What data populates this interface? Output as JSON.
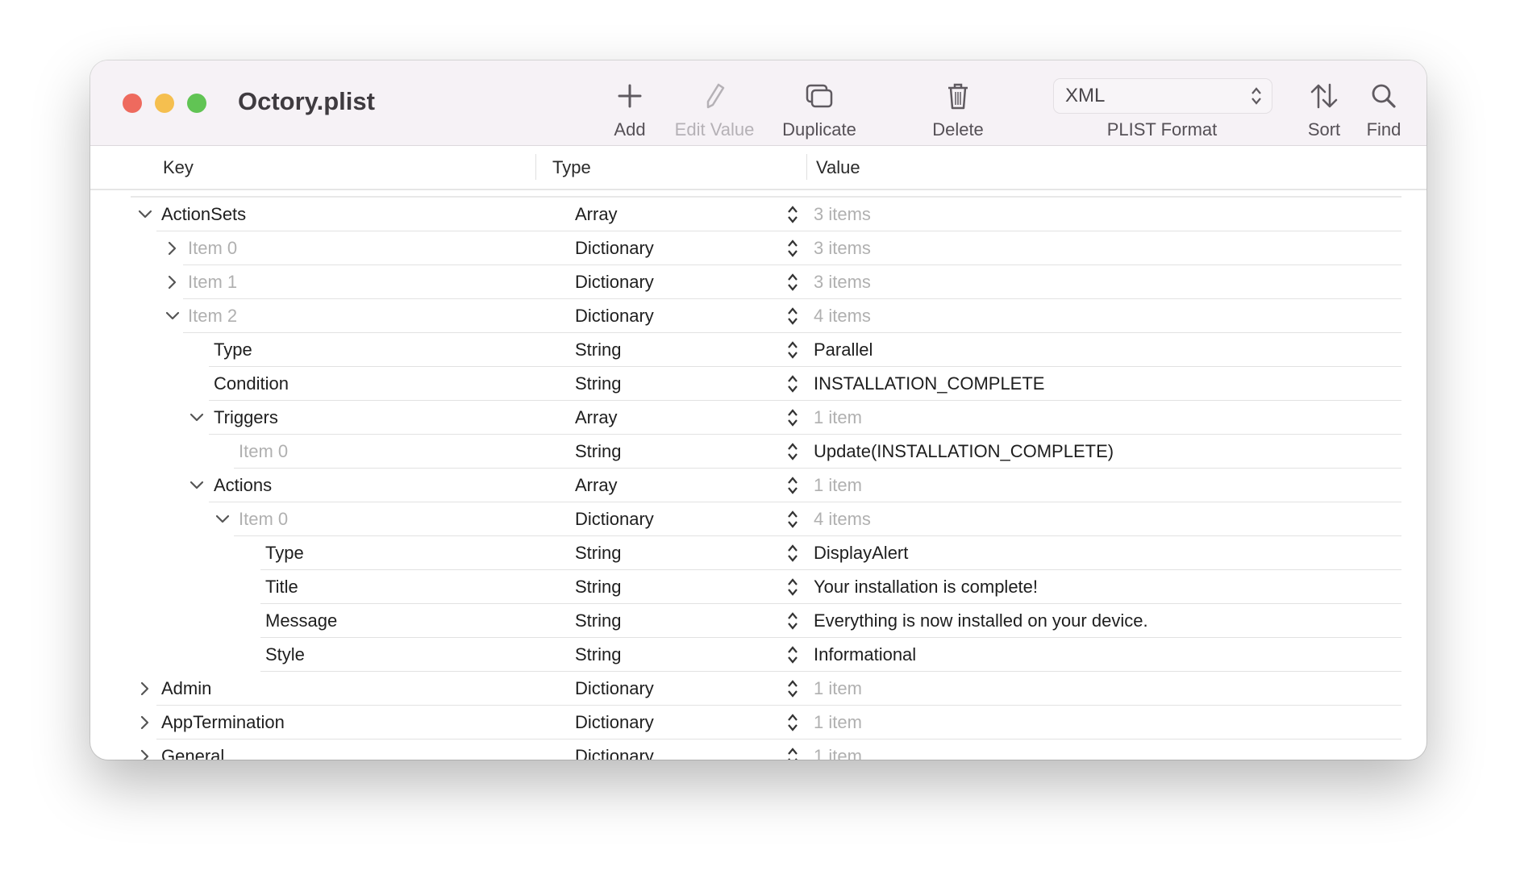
{
  "window": {
    "title": "Octory.plist"
  },
  "colors": {
    "close": "#ee6a5e",
    "minimize": "#f5bf4f",
    "zoom": "#61c454",
    "muted_text": "#b0b0b0"
  },
  "toolbar": {
    "add": {
      "label": "Add",
      "icon": "plus-icon"
    },
    "edit_value": {
      "label": "Edit Value",
      "icon": "pencil-icon",
      "disabled": true
    },
    "duplicate": {
      "label": "Duplicate",
      "icon": "duplicate-icon"
    },
    "delete": {
      "label": "Delete",
      "icon": "trash-icon"
    },
    "format": {
      "value": "XML",
      "label": "PLIST Format"
    },
    "sort": {
      "label": "Sort",
      "icon": "sort-arrows-icon"
    },
    "find": {
      "label": "Find",
      "icon": "magnifier-icon"
    }
  },
  "columns": {
    "key": "Key",
    "type": "Type",
    "value": "Value"
  },
  "rows": [
    {
      "key": "ActionSets",
      "type": "Array",
      "value": "3 items",
      "level": 0,
      "state": "expanded",
      "key_muted": false,
      "value_muted": true
    },
    {
      "key": "Item 0",
      "type": "Dictionary",
      "value": "3 items",
      "level": 1,
      "state": "collapsed",
      "key_muted": true,
      "value_muted": true
    },
    {
      "key": "Item 1",
      "type": "Dictionary",
      "value": "3 items",
      "level": 1,
      "state": "collapsed",
      "key_muted": true,
      "value_muted": true
    },
    {
      "key": "Item 2",
      "type": "Dictionary",
      "value": "4 items",
      "level": 1,
      "state": "expanded",
      "key_muted": true,
      "value_muted": true
    },
    {
      "key": "Type",
      "type": "String",
      "value": "Parallel",
      "level": 2,
      "state": "none",
      "key_muted": false,
      "value_muted": false
    },
    {
      "key": "Condition",
      "type": "String",
      "value": "INSTALLATION_COMPLETE",
      "level": 2,
      "state": "none",
      "key_muted": false,
      "value_muted": false
    },
    {
      "key": "Triggers",
      "type": "Array",
      "value": "1 item",
      "level": 2,
      "state": "expanded",
      "key_muted": false,
      "value_muted": true
    },
    {
      "key": "Item 0",
      "type": "String",
      "value": "Update(INSTALLATION_COMPLETE)",
      "level": 3,
      "state": "none",
      "key_muted": true,
      "value_muted": false
    },
    {
      "key": "Actions",
      "type": "Array",
      "value": "1 item",
      "level": 2,
      "state": "expanded",
      "key_muted": false,
      "value_muted": true
    },
    {
      "key": "Item 0",
      "type": "Dictionary",
      "value": "4 items",
      "level": 3,
      "state": "expanded",
      "key_muted": true,
      "value_muted": true
    },
    {
      "key": "Type",
      "type": "String",
      "value": "DisplayAlert",
      "level": 4,
      "state": "none",
      "key_muted": false,
      "value_muted": false
    },
    {
      "key": "Title",
      "type": "String",
      "value": "Your installation is complete!",
      "level": 4,
      "state": "none",
      "key_muted": false,
      "value_muted": false
    },
    {
      "key": "Message",
      "type": "String",
      "value": "Everything is now installed on your device.",
      "level": 4,
      "state": "none",
      "key_muted": false,
      "value_muted": false
    },
    {
      "key": "Style",
      "type": "String",
      "value": "Informational",
      "level": 4,
      "state": "none",
      "key_muted": false,
      "value_muted": false
    },
    {
      "key": "Admin",
      "type": "Dictionary",
      "value": "1 item",
      "level": 0,
      "state": "collapsed",
      "key_muted": false,
      "value_muted": true
    },
    {
      "key": "AppTermination",
      "type": "Dictionary",
      "value": "1 item",
      "level": 0,
      "state": "collapsed",
      "key_muted": false,
      "value_muted": true
    },
    {
      "key": "General",
      "type": "Dictionary",
      "value": "1 item",
      "level": 0,
      "state": "collapsed",
      "key_muted": false,
      "value_muted": true
    }
  ]
}
